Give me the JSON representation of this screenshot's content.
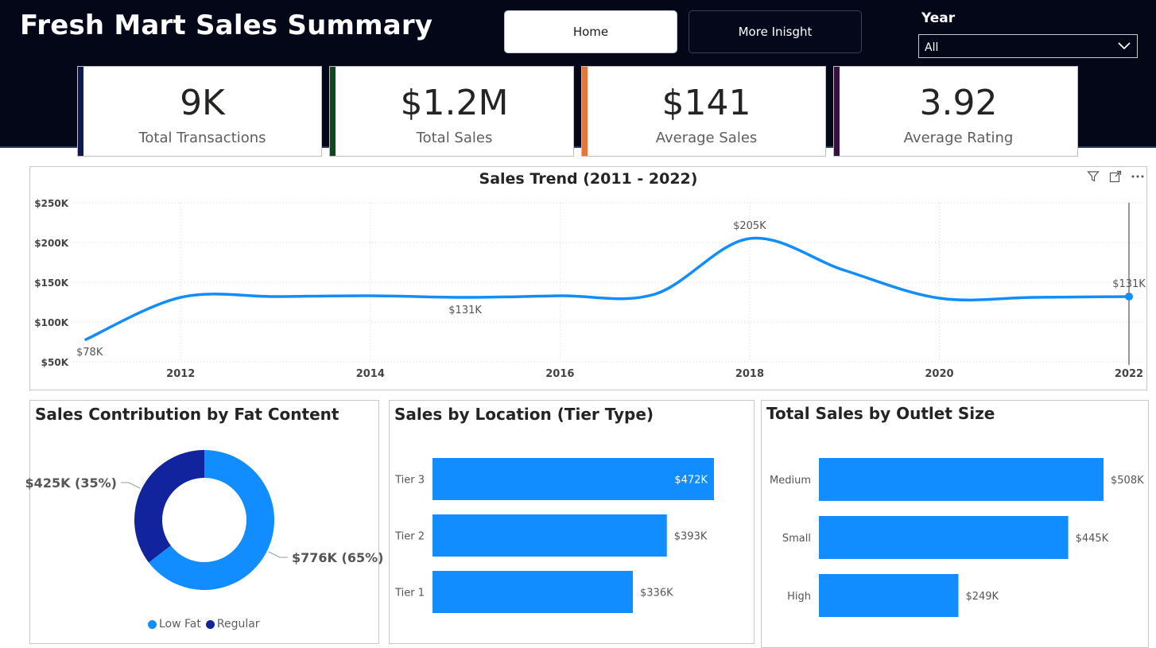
{
  "header": {
    "title": "Fresh Mart Sales Summary",
    "nav": {
      "home_label": "Home",
      "more_label": "More Inisght"
    },
    "year_filter": {
      "label": "Year",
      "selected": "All"
    }
  },
  "kpis": [
    {
      "value": "9K",
      "label": "Total Transactions",
      "accent": "#0f1a4a"
    },
    {
      "value": "$1.2M",
      "label": "Total Sales",
      "accent": "#0c4a1e"
    },
    {
      "value": "$141",
      "label": "Average Sales",
      "accent": "#e8743c"
    },
    {
      "value": "3.92",
      "label": "Average Rating",
      "accent": "#3a0f46"
    }
  ],
  "colors": {
    "line": "#118dff",
    "bar": "#118dff",
    "donut_low_fat": "#118dff",
    "donut_regular": "#12239e",
    "header_bg": "#030717"
  },
  "chart_data": [
    {
      "type": "line",
      "title": "Sales Trend (2011 - 2022)",
      "x": [
        2011,
        2012,
        2013,
        2014,
        2015,
        2016,
        2017,
        2018,
        2019,
        2020,
        2021,
        2022
      ],
      "x_ticks": [
        2012,
        2014,
        2016,
        2018,
        2020,
        2022
      ],
      "series": [
        {
          "values": [
            78,
            131,
            132,
            133,
            131,
            133,
            135,
            205,
            165,
            130,
            131,
            132
          ]
        }
      ],
      "y_unit": "thousand $",
      "y_ticks": [
        "$50K",
        "$100K",
        "$150K",
        "$200K",
        "$250K"
      ],
      "ylim": [
        50,
        250
      ],
      "data_labels": [
        {
          "x": 2011,
          "value": 78,
          "text": "$78K"
        },
        {
          "x": 2015,
          "value": 131,
          "text": "$131K"
        },
        {
          "x": 2018,
          "value": 205,
          "text": "$205K"
        },
        {
          "x": 2022,
          "value": 132,
          "text": "$131K"
        }
      ],
      "grid": true
    },
    {
      "type": "pie",
      "donut": true,
      "title": "Sales Contribution by Fat Content",
      "slices": [
        {
          "name": "Low Fat",
          "value": 776,
          "percent": 65,
          "label": "$776K (65%)"
        },
        {
          "name": "Regular",
          "value": 425,
          "percent": 35,
          "label": "$425K (35%)"
        }
      ],
      "legend": [
        "Low Fat",
        "Regular"
      ],
      "legend_position": "bottom"
    },
    {
      "type": "bar",
      "orientation": "horizontal",
      "title": "Sales by Location (Tier Type)",
      "categories": [
        "Tier 3",
        "Tier 2",
        "Tier 1"
      ],
      "values": [
        472,
        393,
        336
      ],
      "value_labels": [
        "$472K",
        "$393K",
        "$336K"
      ],
      "xlim": [
        0,
        472
      ]
    },
    {
      "type": "bar",
      "orientation": "horizontal",
      "title": "Total Sales by Outlet Size",
      "categories": [
        "Medium",
        "Small",
        "High"
      ],
      "values": [
        508,
        445,
        249
      ],
      "value_labels": [
        "$508K",
        "$445K",
        "$249K"
      ],
      "xlim": [
        0,
        508
      ]
    }
  ]
}
